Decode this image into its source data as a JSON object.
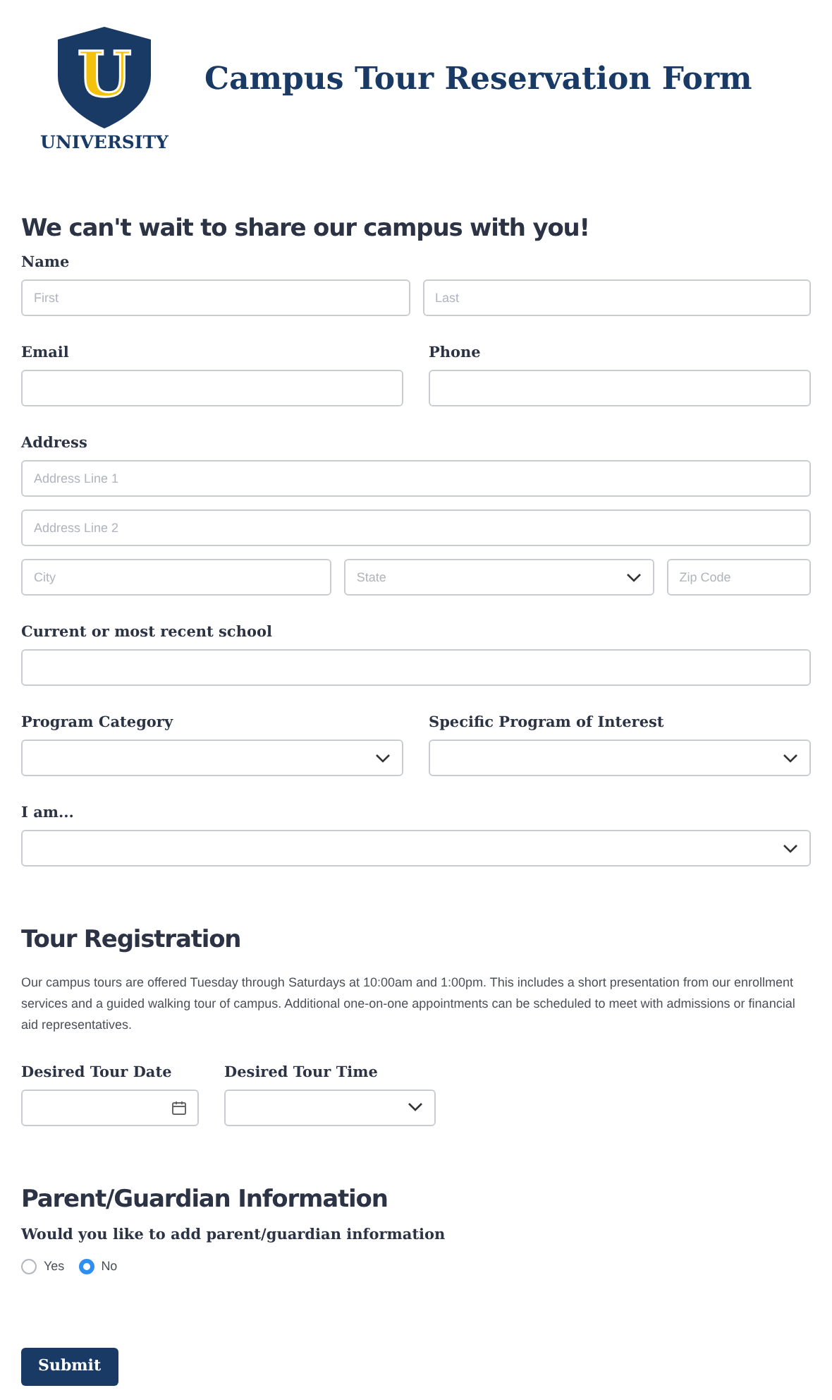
{
  "logo": {
    "letter": "U",
    "text": "UNIVERSITY"
  },
  "title": "Campus Tour Reservation Form",
  "intro_heading": "We can't wait to share our campus with you!",
  "contact_rows": [
    [
      {
        "label": "Name",
        "lines": [
          [
            {
              "kind": "text",
              "placeholder": "First"
            },
            {
              "kind": "text",
              "placeholder": "Last"
            }
          ]
        ]
      }
    ],
    [
      {
        "label": "Email",
        "lines": [
          [
            {
              "kind": "text"
            }
          ]
        ]
      },
      {
        "label": "Phone",
        "lines": [
          [
            {
              "kind": "text"
            }
          ]
        ]
      }
    ],
    [
      {
        "label": "Address",
        "lines": [
          [
            {
              "kind": "text",
              "placeholder": "Address Line 1"
            }
          ],
          [
            {
              "kind": "text",
              "placeholder": "Address Line 2"
            }
          ],
          [
            {
              "kind": "text",
              "placeholder": "City"
            },
            {
              "kind": "select",
              "placeholder": "State"
            },
            {
              "kind": "text",
              "placeholder": "Zip Code"
            }
          ]
        ]
      }
    ],
    [
      {
        "label": "Current or most recent school",
        "lines": [
          [
            {
              "kind": "text"
            }
          ]
        ]
      }
    ],
    [
      {
        "label": "Program Category",
        "lines": [
          [
            {
              "kind": "select"
            }
          ]
        ]
      },
      {
        "label": "Specific Program of Interest",
        "lines": [
          [
            {
              "kind": "select"
            }
          ]
        ]
      }
    ],
    [
      {
        "label": "I am...",
        "lines": [
          [
            {
              "kind": "select"
            }
          ]
        ]
      }
    ]
  ],
  "tour": {
    "heading": "Tour Registration",
    "text": "Our campus tours are offered Tuesday through Saturdays at 10:00am and 1:00pm. This includes a short presentation from our enrollment services and a guided walking tour of campus. Additional one-on-one appointments can be scheduled to meet with admissions or financial aid representatives.",
    "fields": [
      {
        "label": "Desired Tour Date",
        "kind": "date"
      },
      {
        "label": "Desired Tour Time",
        "kind": "select"
      }
    ]
  },
  "parent": {
    "heading": "Parent/Guardian Information",
    "question": "Would you like to add parent/guardian information",
    "options": [
      {
        "label": "Yes",
        "selected": false
      },
      {
        "label": "No",
        "selected": true
      }
    ]
  },
  "submit": "Submit"
}
